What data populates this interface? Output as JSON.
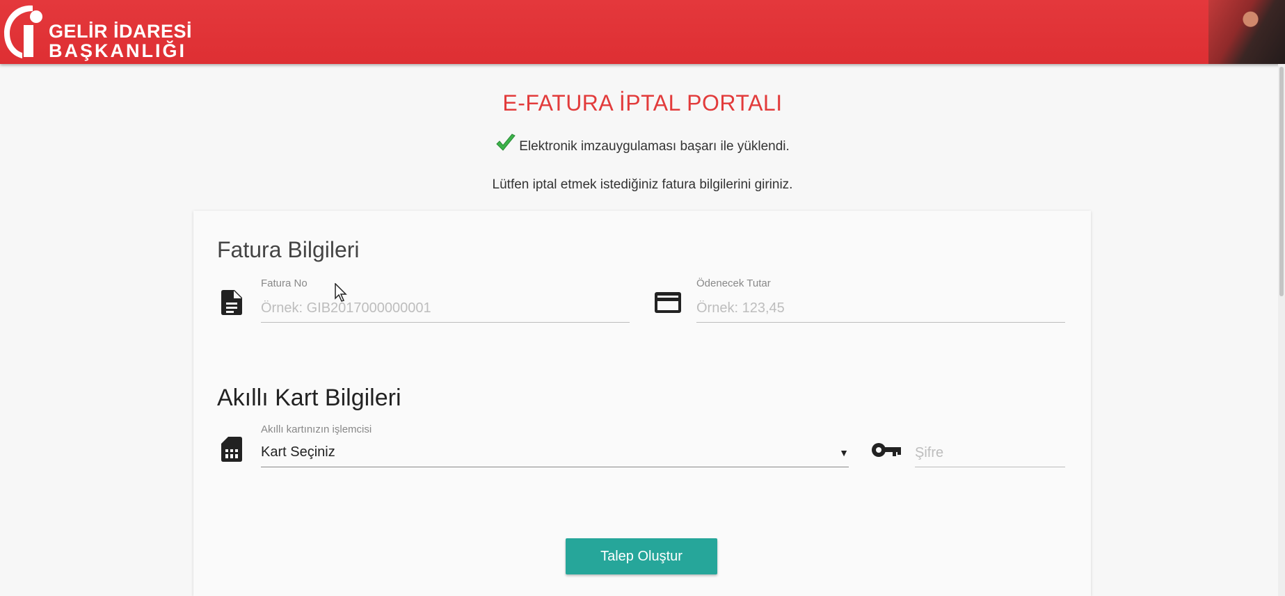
{
  "header": {
    "logo_line1": "GELİR İDARESİ",
    "logo_line2": "BAŞKANLIĞI",
    "accent_color": "#e3363a"
  },
  "page": {
    "title": "E-FATURA İPTAL PORTALI",
    "status_message": "Elektronik imzauygulaması başarı ile yüklendi.",
    "instruction": "Lütfen iptal etmek istediğiniz fatura bilgilerini giriniz."
  },
  "invoice_section": {
    "title": "Fatura Bilgileri",
    "invoice_no": {
      "label": "Fatura No",
      "placeholder": "Örnek: GIB2017000000001",
      "icon": "document-icon"
    },
    "amount": {
      "label": "Ödenecek Tutar",
      "placeholder": "Örnek: 123,45",
      "icon": "credit-card-icon"
    }
  },
  "card_section": {
    "title": "Akıllı Kart Bilgileri",
    "reader": {
      "label": "Akıllı kartınızın işlemcisi",
      "selected": "Kart Seçiniz",
      "icon": "sim-card-icon"
    },
    "password": {
      "placeholder": "Şifre",
      "icon": "key-icon"
    }
  },
  "actions": {
    "submit_label": "Talep Oluştur",
    "button_color": "#26a69a"
  }
}
